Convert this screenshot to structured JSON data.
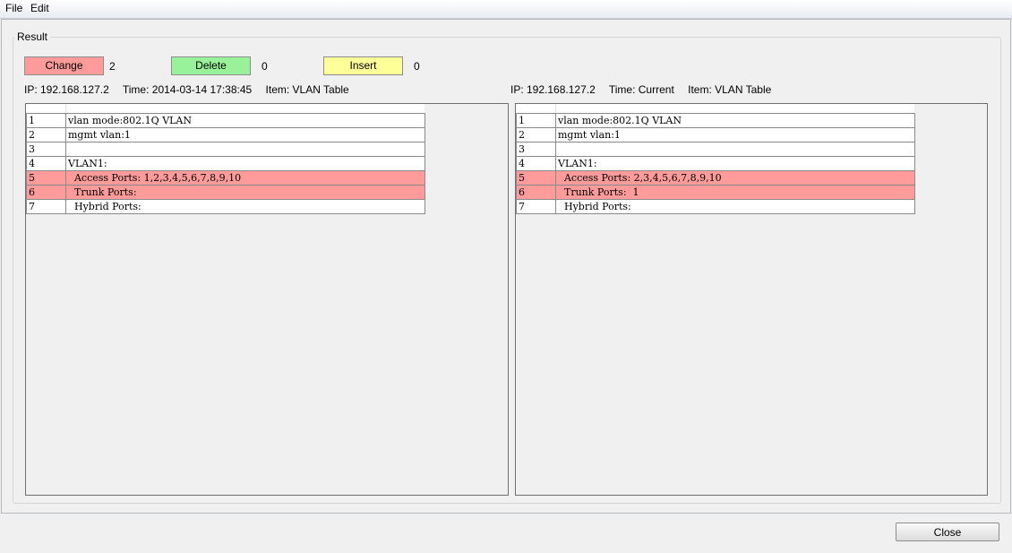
{
  "menu": {
    "file": "File",
    "edit": "Edit"
  },
  "group_title": "Result",
  "legend": {
    "change": {
      "label": "Change",
      "count": "2",
      "color": "#ff9b9b"
    },
    "delete": {
      "label": "Delete",
      "count": "0",
      "color": "#99f299"
    },
    "insert": {
      "label": "Insert",
      "count": "0",
      "color": "#ffff99"
    }
  },
  "left": {
    "ip": "IP: 192.168.127.2",
    "time": "Time: 2014-03-14 17:38:45",
    "item": "Item: VLAN Table",
    "rows": [
      {
        "num": "1",
        "text": "vlan mode:802.1Q VLAN",
        "changed": false
      },
      {
        "num": "2",
        "text": "mgmt vlan:1",
        "changed": false
      },
      {
        "num": "3",
        "text": "",
        "changed": false
      },
      {
        "num": "4",
        "text": "VLAN1:",
        "changed": false
      },
      {
        "num": "5",
        "text": "  Access Ports: 1,2,3,4,5,6,7,8,9,10",
        "changed": true
      },
      {
        "num": "6",
        "text": "  Trunk Ports:",
        "changed": true
      },
      {
        "num": "7",
        "text": "  Hybrid Ports:",
        "changed": false
      }
    ]
  },
  "right": {
    "ip": "IP: 192.168.127.2",
    "time": "Time: Current",
    "item": "Item: VLAN Table",
    "rows": [
      {
        "num": "1",
        "text": "vlan mode:802.1Q VLAN",
        "changed": false
      },
      {
        "num": "2",
        "text": "mgmt vlan:1",
        "changed": false
      },
      {
        "num": "3",
        "text": "",
        "changed": false
      },
      {
        "num": "4",
        "text": "VLAN1:",
        "changed": false
      },
      {
        "num": "5",
        "text": "  Access Ports: 2,3,4,5,6,7,8,9,10",
        "changed": true
      },
      {
        "num": "6",
        "text": "  Trunk Ports:  1",
        "changed": true
      },
      {
        "num": "7",
        "text": "  Hybrid Ports:",
        "changed": false
      }
    ]
  },
  "close_label": "Close"
}
